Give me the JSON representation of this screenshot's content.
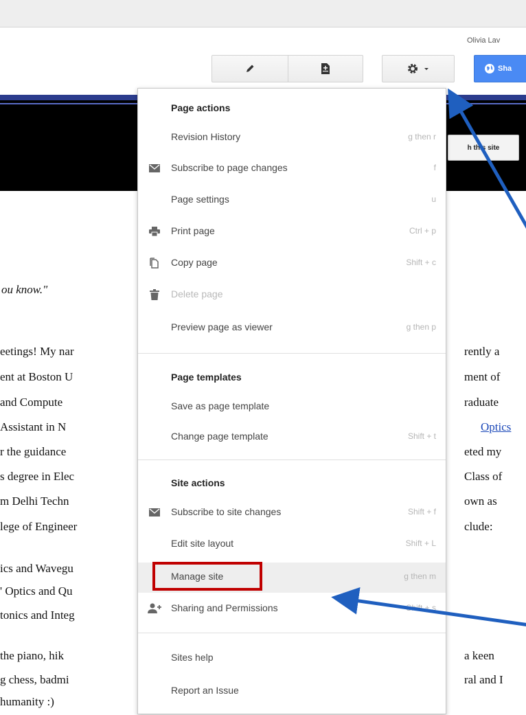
{
  "header": {
    "user_name": "Olivia Lav",
    "share_label": "Sha",
    "search_label": "h this site"
  },
  "toolbar": {
    "edit_icon": "pencil-icon",
    "new_page_icon": "new-page-icon",
    "more_icon": "gear-icon"
  },
  "page": {
    "quote": "ou know.\"",
    "left_lines": [
      "eetings! My nar",
      "ent at Boston U",
      " and  Compute",
      " Assistant  in  N",
      "r  the  guidance",
      "s  degree in Elec",
      "m Delhi Techn",
      "lege of Engineer",
      "ics and Wavegu",
      "' Optics and Qu",
      "tonics and Integ",
      " the  piano,  hik",
      "g chess, badmi",
      " humanity :)"
    ],
    "right_lines": [
      "rently a",
      "ment of",
      "raduate",
      "Optics",
      "eted my",
      "Class of",
      "own as",
      "clude:",
      "a keen",
      "ral and I"
    ]
  },
  "menu": {
    "page_actions_title": "Page actions",
    "page_templates_title": "Page templates",
    "site_actions_title": "Site actions",
    "items": [
      {
        "label": "Revision History",
        "shortcut": "g then r"
      },
      {
        "label": "Subscribe to page changes",
        "shortcut": "f",
        "icon": "envelope-icon"
      },
      {
        "label": "Page settings",
        "shortcut": "u"
      },
      {
        "label": "Print page",
        "shortcut": "Ctrl + p",
        "icon": "printer-icon"
      },
      {
        "label": "Copy page",
        "shortcut": "Shift + c",
        "icon": "copy-icon"
      },
      {
        "label": "Delete page",
        "shortcut": "",
        "icon": "trash-icon"
      },
      {
        "label": "Preview page as viewer",
        "shortcut": "g then p"
      },
      {
        "label": "Save as page template",
        "shortcut": ""
      },
      {
        "label": "Change page template",
        "shortcut": "Shift + t"
      },
      {
        "label": "Subscribe to site changes",
        "shortcut": "Shift + f",
        "icon": "envelope-icon"
      },
      {
        "label": "Edit site layout",
        "shortcut": "Shift + L"
      },
      {
        "label": "Manage site",
        "shortcut": "g then m"
      },
      {
        "label": "Sharing and Permissions",
        "shortcut": "Shift + s",
        "icon": "add-person-icon"
      },
      {
        "label": "Sites help",
        "shortcut": ""
      },
      {
        "label": "Report an Issue",
        "shortcut": ""
      }
    ]
  },
  "colors": {
    "highlight": "#c00000",
    "arrow": "#1f5fbf",
    "share_button": "#4a8af4",
    "header_band": "#000000"
  }
}
